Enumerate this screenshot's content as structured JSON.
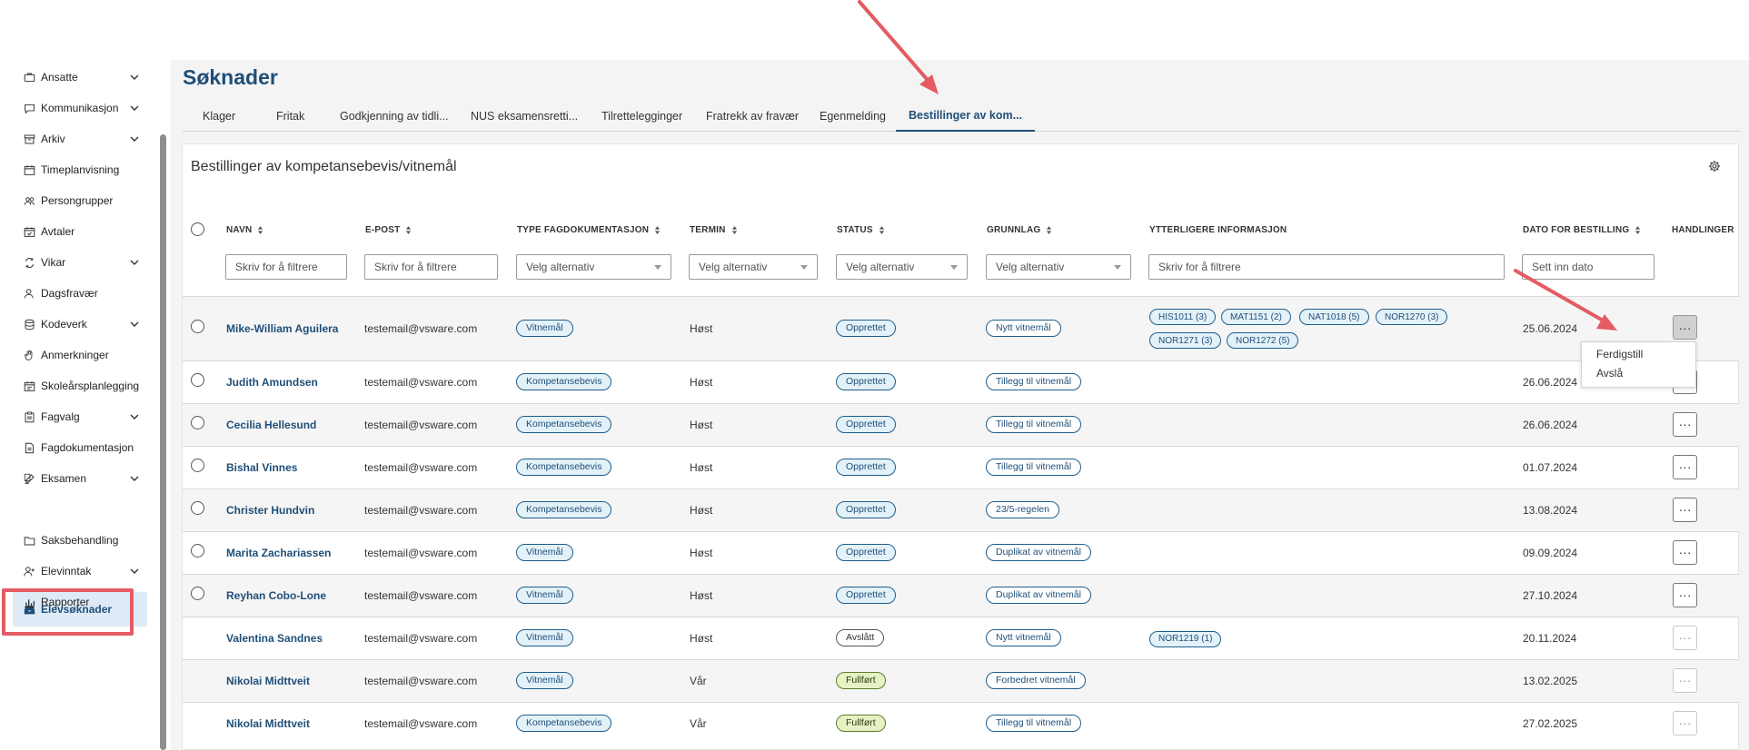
{
  "sidebar": {
    "items": [
      {
        "label": "Ansatte",
        "icon": "briefcase-icon",
        "chevron": true
      },
      {
        "label": "Kommunikasjon",
        "icon": "chat-icon",
        "chevron": true
      },
      {
        "label": "Arkiv",
        "icon": "archive-icon",
        "chevron": true
      },
      {
        "label": "Timeplanvisning",
        "icon": "calendar-icon",
        "chevron": false
      },
      {
        "label": "Persongrupper",
        "icon": "people-icon",
        "chevron": false
      },
      {
        "label": "Avtaler",
        "icon": "calendar-check-icon",
        "chevron": false
      },
      {
        "label": "Vikar",
        "icon": "swap-icon",
        "chevron": true
      },
      {
        "label": "Dagsfravær",
        "icon": "person-icon",
        "chevron": false
      },
      {
        "label": "Kodeverk",
        "icon": "database-icon",
        "chevron": true
      },
      {
        "label": "Anmerkninger",
        "icon": "hand-icon",
        "chevron": false
      },
      {
        "label": "Skoleårsplanlegging",
        "icon": "calendar-plan-icon",
        "chevron": false
      },
      {
        "label": "Fagvalg",
        "icon": "clipboard-icon",
        "chevron": true
      },
      {
        "label": "Fagdokumentasjon",
        "icon": "document-icon",
        "chevron": false
      },
      {
        "label": "Eksamen",
        "icon": "edit-icon",
        "chevron": true
      },
      {
        "label": "Elevsøknader",
        "icon": "inbox-icon",
        "chevron": false,
        "active": true
      },
      {
        "label": "Saksbehandling",
        "icon": "folder-icon",
        "chevron": false
      },
      {
        "label": "Elevinntak",
        "icon": "person-add-icon",
        "chevron": true
      },
      {
        "label": "Rapporter",
        "icon": "bar-chart-icon",
        "chevron": false
      }
    ]
  },
  "page": {
    "title": "Søknader",
    "tabs": [
      "Klager",
      "Fritak",
      "Godkjenning av tidli...",
      "NUS eksamensretti...",
      "Tilrettelegginger",
      "Fratrekk av fravær",
      "Egenmelding",
      "Bestillinger av kom..."
    ],
    "active_tab_index": 7
  },
  "card": {
    "title": "Bestillinger av kompetansebevis/vitnemål"
  },
  "table": {
    "headers": {
      "navn": "NAVN",
      "epost": "E-POST",
      "type": "TYPE FAGDOKUMENTASJON",
      "termin": "TERMIN",
      "status": "STATUS",
      "grunnlag": "GRUNNLAG",
      "ytterligere": "YTTERLIGERE INFORMASJON",
      "dato": "DATO FOR BESTILLING",
      "handlinger": "HANDLINGER"
    },
    "filters": {
      "text_placeholder": "Skriv for å filtrere",
      "select_placeholder": "Velg alternativ",
      "date_placeholder": "Sett inn dato"
    },
    "rows": [
      {
        "name": "Mike-William Aguilera",
        "email": "testemail@vsware.com",
        "type": "Vitnemål",
        "termin": "Høst",
        "status": "Opprettet",
        "grunnlag": "Nytt vitnemål",
        "info": [
          "HIS1011 (3)",
          "MAT1151 (2)",
          "NAT1018 (5)",
          "NOR1270 (3)",
          "NOR1271 (3)",
          "NOR1272 (5)"
        ],
        "dato": "25.06.2024",
        "checkbox": true
      },
      {
        "name": "Judith Amundsen",
        "email": "testemail@vsware.com",
        "type": "Kompetansebevis",
        "termin": "Høst",
        "status": "Opprettet",
        "grunnlag": "Tillegg til vitnemål",
        "info": [],
        "dato": "26.06.2024",
        "checkbox": true
      },
      {
        "name": "Cecilia Hellesund",
        "email": "testemail@vsware.com",
        "type": "Kompetansebevis",
        "termin": "Høst",
        "status": "Opprettet",
        "grunnlag": "Tillegg til vitnemål",
        "info": [],
        "dato": "26.06.2024",
        "checkbox": true
      },
      {
        "name": "Bishal Vinnes",
        "email": "testemail@vsware.com",
        "type": "Kompetansebevis",
        "termin": "Høst",
        "status": "Opprettet",
        "grunnlag": "Tillegg til vitnemål",
        "info": [],
        "dato": "01.07.2024",
        "checkbox": true
      },
      {
        "name": "Christer Hundvin",
        "email": "testemail@vsware.com",
        "type": "Kompetansebevis",
        "termin": "Høst",
        "status": "Opprettet",
        "grunnlag": "23/5-regelen",
        "info": [],
        "dato": "13.08.2024",
        "checkbox": true
      },
      {
        "name": "Marita Zachariassen",
        "email": "testemail@vsware.com",
        "type": "Vitnemål",
        "termin": "Høst",
        "status": "Opprettet",
        "grunnlag": "Duplikat av vitnemål",
        "info": [],
        "dato": "09.09.2024",
        "checkbox": true
      },
      {
        "name": "Reyhan Cobo-Lone",
        "email": "testemail@vsware.com",
        "type": "Vitnemål",
        "termin": "Høst",
        "status": "Opprettet",
        "grunnlag": "Duplikat av vitnemål",
        "info": [],
        "dato": "27.10.2024",
        "checkbox": true
      },
      {
        "name": "Valentina Sandnes",
        "email": "testemail@vsware.com",
        "type": "Vitnemål",
        "termin": "Høst",
        "status": "Avslått",
        "grunnlag": "Nytt vitnemål",
        "info": [
          "NOR1219 (1)"
        ],
        "dato": "20.11.2024",
        "checkbox": false
      },
      {
        "name": "Nikolai Midttveit",
        "email": "testemail@vsware.com",
        "type": "Vitnemål",
        "termin": "Vår",
        "status": "Fullført",
        "grunnlag": "Forbedret vitnemål",
        "info": [],
        "dato": "13.02.2025",
        "checkbox": false
      },
      {
        "name": "Nikolai Midttveit",
        "email": "testemail@vsware.com",
        "type": "Kompetansebevis",
        "termin": "Vår",
        "status": "Fullført",
        "grunnlag": "Tillegg til vitnemål",
        "info": [],
        "dato": "27.02.2025",
        "checkbox": false
      }
    ],
    "action_glyph": "···"
  },
  "action_menu": {
    "items": [
      "Ferdigstill",
      "Avslå"
    ]
  },
  "colors": {
    "brand": "#1f4f79",
    "annotation": "#e55b63",
    "complete_green": "#e6f2c4"
  }
}
